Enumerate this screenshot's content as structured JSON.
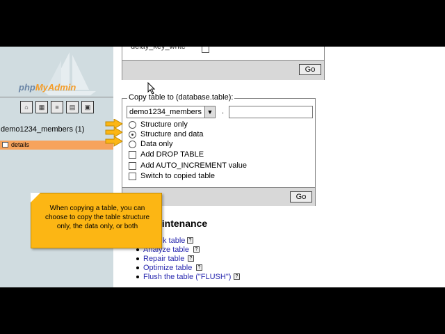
{
  "sidebar": {
    "logo_brand_a": "php",
    "logo_brand_b": "MyAdmin",
    "nav_icons": [
      "home-icon",
      "database-icon",
      "sql-icon",
      "docs-icon",
      "query-icon"
    ],
    "database_label": "demo1234_members (1)",
    "table_item": "details"
  },
  "options": {
    "delay_key_write_label": "delay_key_write",
    "go_label": "Go"
  },
  "copy_table": {
    "legend": "Copy table to (database.table):",
    "database_value": "demo1234_members",
    "separator": ".",
    "target_table_value": "",
    "radio_options": [
      {
        "label": "Structure only",
        "checked": false
      },
      {
        "label": "Structure and data",
        "checked": true
      },
      {
        "label": "Data only",
        "checked": false
      }
    ],
    "checkbox_options": [
      {
        "label": "Add DROP TABLE",
        "checked": false
      },
      {
        "label": "Add AUTO_INCREMENT value",
        "checked": false
      },
      {
        "label": "Switch to copied table",
        "checked": false
      }
    ],
    "go_label": "Go"
  },
  "maintenance": {
    "title": "aintenance",
    "links": [
      "k table",
      "Analyze table",
      "Repair table",
      "Optimize table",
      "Flush the table (\"FLUSH\")"
    ]
  },
  "callout": {
    "text": "When copying a table, you can choose to copy the table structure only, the data only, or both"
  },
  "colors": {
    "accent_orange": "#f7a35c",
    "callout_yellow": "#fcb614",
    "link_blue": "#2a2ab0",
    "sidebar_bg": "#d0dce0"
  }
}
